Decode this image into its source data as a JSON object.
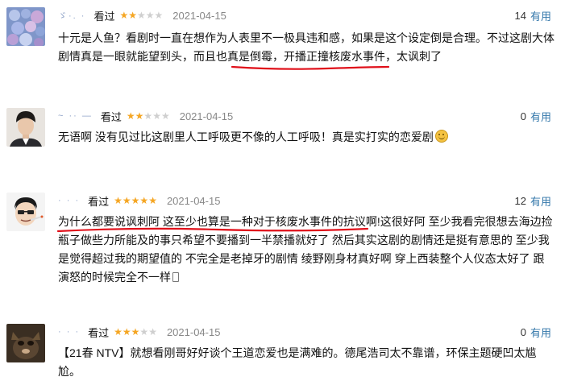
{
  "reviews": [
    {
      "user": "ゞ·. ·",
      "seen_label": "看过",
      "rating": 2,
      "date": "2021-04-15",
      "useful_count": "14",
      "useful_label": "有用",
      "avatar_icon": "hydrangea-avatar",
      "content": "十元是人鱼？看剧时一直在想作为人表里不一极具违和感，如果是这个设定倒是合理。不过这剧大体剧情真是一眼就能望到头，而且也真是倒霉，开播正撞核废水事件，太讽刺了"
    },
    {
      "user": "~ ·· —",
      "seen_label": "看过",
      "rating": 2,
      "date": "2021-04-15",
      "useful_count": "0",
      "useful_label": "有用",
      "avatar_icon": "man-portrait-avatar",
      "content": "无语啊 没有见过比这剧里人工呼吸更不像的人工呼吸！真是实打实的恋爱剧"
    },
    {
      "user": "· · ·",
      "seen_label": "看过",
      "rating": 5,
      "date": "2021-04-15",
      "useful_count": "12",
      "useful_label": "有用",
      "avatar_icon": "cartoon-face-avatar",
      "content": "为什么都要说讽刺阿 这至少也算是一种对于核废水事件的抗议啊!这很好阿 至少我看完很想去海边捡瓶子做些力所能及的事只希望不要播到一半禁播就好了 然后其实这剧的剧情还是挺有意思的 至少我是觉得超过我的期望值的 不完全是老掉牙的剧情 绫野刚身材真好啊 穿上西装整个人仪态太好了 跟演怒的时候完全不一样"
    },
    {
      "user": "· · ·",
      "seen_label": "看过",
      "rating": 3,
      "date": "2021-04-15",
      "useful_count": "0",
      "useful_label": "有用",
      "avatar_icon": "dark-pet-avatar",
      "content": "【21春 NTV】就想看刚哥好好谈个王道恋爱也是满难的。德尾浩司太不靠谱，环保主题硬凹太尴尬。"
    }
  ],
  "colors": {
    "star_on": "#f5a623",
    "star_off": "#cfcfcf",
    "link": "#3377aa",
    "underline": "#e0101a"
  }
}
